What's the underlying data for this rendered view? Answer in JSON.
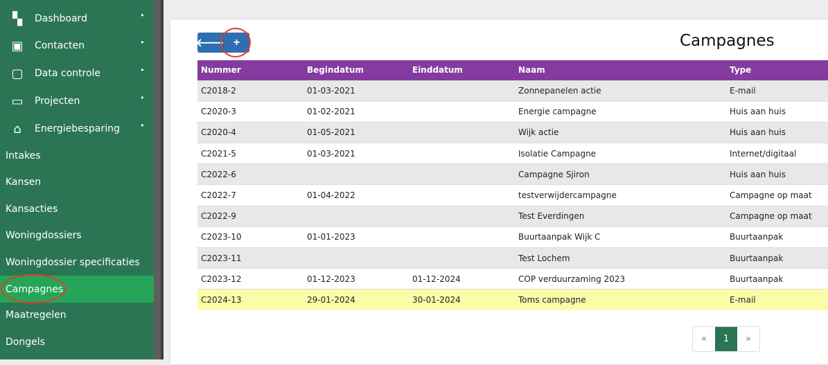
{
  "sidebar": {
    "items": [
      {
        "label": "Dashboard",
        "icon": "dashboard-icon"
      },
      {
        "label": "Contacten",
        "icon": "contact-icon"
      },
      {
        "label": "Data controle",
        "icon": "data-control-icon"
      },
      {
        "label": "Projecten",
        "icon": "inbox-icon"
      },
      {
        "label": "Energiebesparing",
        "icon": "home-icon"
      }
    ],
    "subitems": [
      "Intakes",
      "Kansen",
      "Kansacties",
      "Woningdossiers",
      "Woningdossier specificaties",
      "Campagnes",
      "Maatregelen",
      "Dongels"
    ],
    "active": "Campagnes"
  },
  "toolbar": {
    "back": "🡐",
    "add": "+"
  },
  "page": {
    "title": "Campagnes"
  },
  "table": {
    "headers": [
      "Nummer",
      "Begindatum",
      "Einddatum",
      "Naam",
      "Type"
    ],
    "rows": [
      [
        "C2018-2",
        "01-03-2021",
        "",
        "Zonnepanelen actie",
        "E-mail"
      ],
      [
        "C2020-3",
        "01-02-2021",
        "",
        "Energie campagne",
        "Huis aan huis"
      ],
      [
        "C2020-4",
        "01-05-2021",
        "",
        "Wijk actie",
        "Huis aan huis"
      ],
      [
        "C2021-5",
        "01-03-2021",
        "",
        "Isolatie Campagne",
        "Internet/digitaal"
      ],
      [
        "C2022-6",
        "",
        "",
        "Campagne Sjiron",
        "Huis aan huis"
      ],
      [
        "C2022-7",
        "01-04-2022",
        "",
        "testverwijdercampagne",
        "Campagne op maat"
      ],
      [
        "C2022-9",
        "",
        "",
        "Test Everdingen",
        "Campagne op maat"
      ],
      [
        "C2023-10",
        "01-01-2023",
        "",
        "Buurtaanpak Wijk C",
        "Buurtaanpak"
      ],
      [
        "C2023-11",
        "",
        "",
        "Test Lochem",
        "Buurtaanpak"
      ],
      [
        "C2023-12",
        "01-12-2023",
        "01-12-2024",
        "COP verduurzaming 2023",
        "Buurtaanpak"
      ],
      [
        "C2024-13",
        "29-01-2024",
        "30-01-2024",
        "Toms campagne",
        "E-mail"
      ]
    ]
  },
  "pagination": {
    "prev": "«",
    "current": "1",
    "next": "»"
  }
}
